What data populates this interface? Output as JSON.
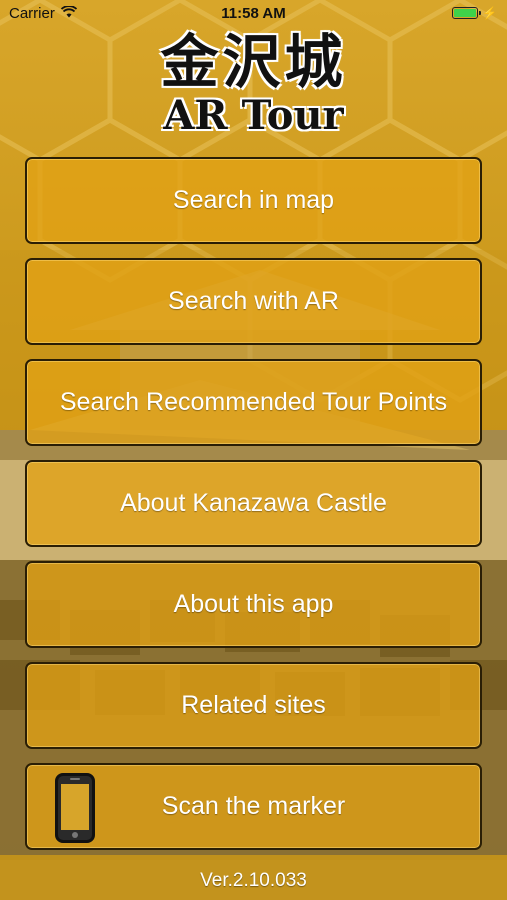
{
  "status_bar": {
    "carrier": "Carrier",
    "time": "11:58 AM"
  },
  "logo": {
    "title_kanji": "金沢城",
    "subtitle": "AR Tour"
  },
  "menu": {
    "items": [
      {
        "label": "Search in map"
      },
      {
        "label": "Search with AR"
      },
      {
        "label": "Search Recommended Tour Points"
      },
      {
        "label": "About Kanazawa Castle"
      },
      {
        "label": "About this app"
      },
      {
        "label": "Related sites"
      },
      {
        "label": "Scan the marker",
        "icon": "smartphone-icon"
      }
    ]
  },
  "footer": {
    "version": "Ver.2.10.033"
  },
  "colors": {
    "background_gold": "#c9961c",
    "button_fill": "#e2a214",
    "button_border": "#2a1e05",
    "battery_green": "#3fd24a"
  }
}
